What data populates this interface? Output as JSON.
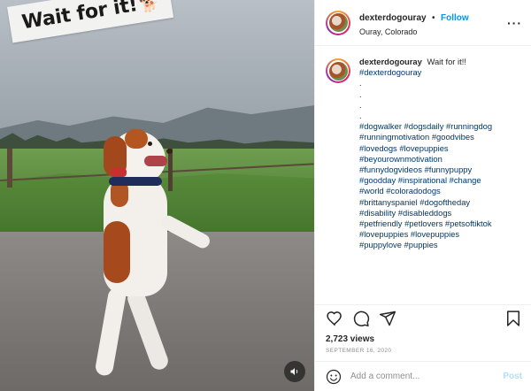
{
  "media": {
    "sticker_text": "Wait for it!",
    "sticker_emoji": "🐕",
    "audio_icon": "speaker-icon"
  },
  "header": {
    "username": "dexterdogouray",
    "separator": "•",
    "follow_label": "Follow",
    "location": "Ouray, Colorado",
    "more_label": "···"
  },
  "caption": {
    "username": "dexterdogouray",
    "text": "Wait for it!!",
    "first_tag": "#dexterdogouray",
    "dots": [
      ".",
      ".",
      ".",
      "."
    ],
    "hashtag_lines": [
      "#dogwalker #dogsdaily #runningdog",
      "#runningmotivation #goodvibes",
      "#lovedogs #lovepuppies",
      "#beyourownmotivation",
      "#funnydogvideos #funnypuppy",
      "#goodday #inspirational #change",
      "#world #coloradodogs",
      "#brittanyspaniel #dogoftheday",
      "#disability #disableddogs",
      "#petfriendly #petlovers #petsoftiktok",
      "#lovepuppies #lovepuppies",
      "#puppylove #puppies"
    ]
  },
  "stats": {
    "views": "2,723 views",
    "date": "SEPTEMBER 16, 2020"
  },
  "comment_box": {
    "placeholder": "Add a comment...",
    "post_label": "Post"
  },
  "colors": {
    "link": "#00376b",
    "follow": "#0095f6",
    "post_disabled": "#b2dffc"
  }
}
